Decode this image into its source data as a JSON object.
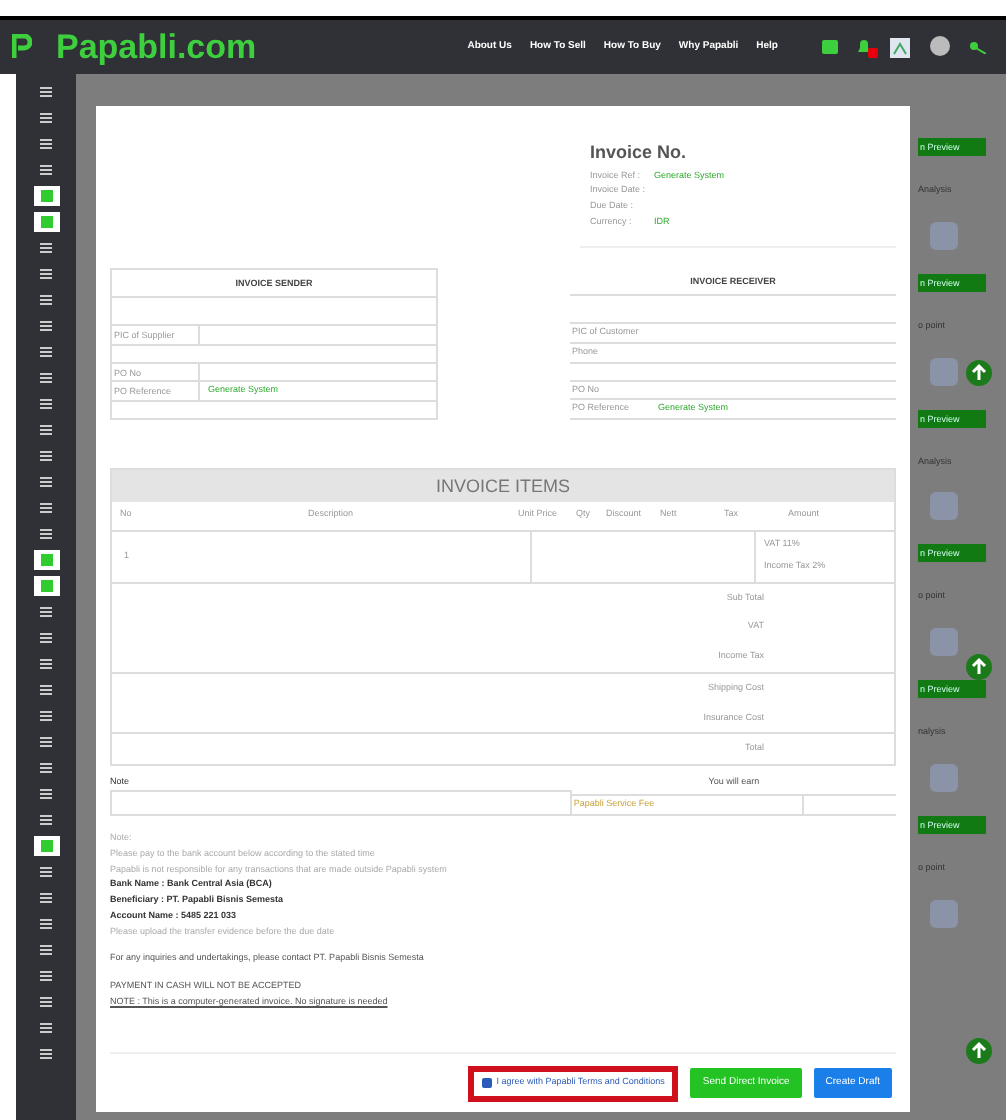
{
  "header": {
    "logo": "Papabli.com",
    "nav": [
      "About Us",
      "How To Sell",
      "How To Buy",
      "Why Papabli",
      "Help"
    ]
  },
  "sidebar": {
    "items": [
      {
        "selected": false
      },
      {
        "selected": false
      },
      {
        "selected": false
      },
      {
        "selected": false
      },
      {
        "selected": true
      },
      {
        "selected": true
      },
      {
        "selected": false
      },
      {
        "selected": false
      },
      {
        "selected": false
      },
      {
        "selected": false
      },
      {
        "selected": false
      },
      {
        "selected": false
      },
      {
        "selected": false
      },
      {
        "selected": false
      },
      {
        "selected": false
      },
      {
        "selected": false
      },
      {
        "selected": false
      },
      {
        "selected": false
      },
      {
        "selected": true
      },
      {
        "selected": true
      },
      {
        "selected": false
      },
      {
        "selected": false
      },
      {
        "selected": false
      },
      {
        "selected": false
      },
      {
        "selected": false
      },
      {
        "selected": false
      },
      {
        "selected": false
      },
      {
        "selected": false
      },
      {
        "selected": false
      },
      {
        "selected": true
      },
      {
        "selected": false
      },
      {
        "selected": false
      },
      {
        "selected": false
      },
      {
        "selected": false
      },
      {
        "selected": false
      },
      {
        "selected": false
      },
      {
        "selected": false
      },
      {
        "selected": false
      }
    ]
  },
  "invoice": {
    "title": "Invoice No.",
    "meta": [
      {
        "label": "Invoice Ref :",
        "value": "Generate System"
      },
      {
        "label": "Invoice Date :"
      },
      {
        "label": "Due Date :"
      },
      {
        "label": "Currency :",
        "value": "IDR"
      }
    ]
  },
  "sender": {
    "title": "INVOICE SENDER",
    "rows": [
      {
        "label": "PIC of Supplier"
      },
      {
        "label": "PO No"
      },
      {
        "label": "PO Reference",
        "value": "Generate System"
      }
    ]
  },
  "receiver": {
    "title": "INVOICE RECEIVER",
    "rows": [
      {
        "label": "PIC of Customer"
      },
      {
        "label": "Phone"
      },
      {
        "label": "PO No"
      },
      {
        "label": "PO Reference",
        "value": "Generate System"
      }
    ]
  },
  "items": {
    "title": "INVOICE ITEMS",
    "columns": [
      "No",
      "Description",
      "Unit Price",
      "Qty",
      "Discount",
      "Nett",
      "Tax",
      "Amount"
    ],
    "rows": [
      {
        "no": "1",
        "taxes": [
          "VAT 11%",
          "Income Tax 2%"
        ]
      }
    ],
    "totals": [
      [
        "Sub Total",
        "VAT",
        "Income Tax"
      ],
      [
        "Shipping Cost",
        "Insurance Cost"
      ],
      [
        "Total"
      ]
    ]
  },
  "note": {
    "label": "Note"
  },
  "earn": {
    "title": "You will earn",
    "fee": "Papabli Service Fee"
  },
  "notes": [
    {
      "text": "Note:",
      "kind": "plain"
    },
    {
      "text": "Please pay to the bank account below according to the stated time",
      "kind": "plain"
    },
    {
      "text": "Papabli is not responsible for any transactions that are made outside Papabli system",
      "kind": "plain"
    },
    {
      "text": "Bank Name : Bank Central Asia (BCA)",
      "kind": "bold"
    },
    {
      "text": "Beneficiary : PT. Papabli Bisnis Semesta",
      "kind": "bold"
    },
    {
      "text": "Account Name : 5485 221 033",
      "kind": "bold"
    },
    {
      "text": "Please upload the transfer evidence before the due date",
      "kind": "plain"
    },
    {
      "text": "For any inquiries and undertakings, please contact PT. Papabli Bisnis Semesta",
      "kind": "gap"
    },
    {
      "text": "PAYMENT IN CASH WILL NOT BE ACCEPTED",
      "kind": "gap"
    },
    {
      "text": "NOTE : This is a computer-generated invoice. No signature is needed",
      "kind": "link"
    }
  ],
  "agree": {
    "label": "I agree with Papabli Terms and Conditions",
    "checked": true
  },
  "buttons": [
    {
      "label": "Send Direct Invoice",
      "kind": "send"
    },
    {
      "label": "Create Draft",
      "kind": "draft"
    }
  ],
  "side_cards": [
    {
      "label": "n Preview",
      "kind": "button"
    },
    {
      "label": "Analysis",
      "kind": "title"
    },
    {
      "label": "n Preview",
      "kind": "button"
    },
    {
      "label": "o point",
      "kind": "title"
    },
    {
      "label": "n Preview",
      "kind": "button"
    },
    {
      "label": "Analysis",
      "kind": "title"
    },
    {
      "label": "n Preview",
      "kind": "button"
    },
    {
      "label": "o point",
      "kind": "title"
    },
    {
      "label": "n Preview",
      "kind": "button"
    },
    {
      "label": "nalysis",
      "kind": "title"
    },
    {
      "label": "n Preview",
      "kind": "button"
    },
    {
      "label": "o point",
      "kind": "title"
    }
  ]
}
